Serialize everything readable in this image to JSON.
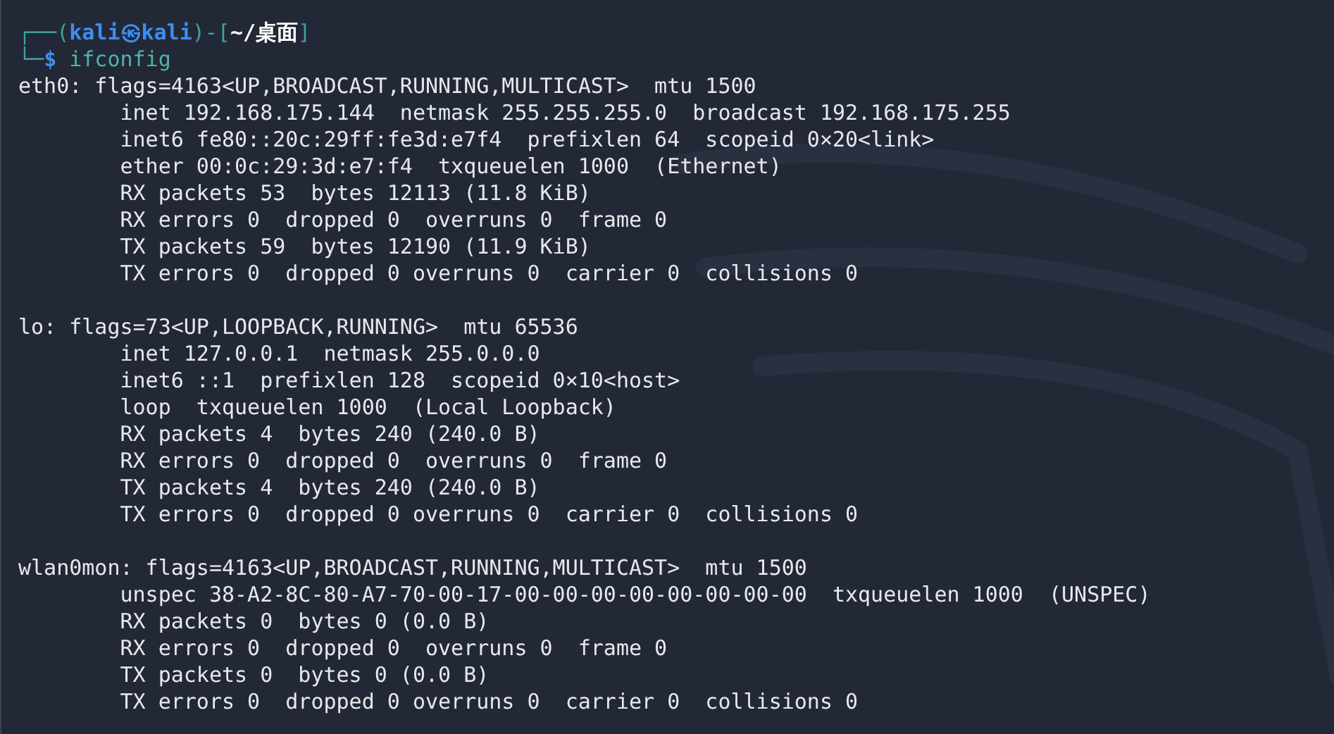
{
  "prompt": {
    "corner_top": "┌──(",
    "user": "kali",
    "separator": "㉿",
    "host": "kali",
    "bracket_mid": ")-[",
    "path": "~/桌面",
    "bracket_close": "]",
    "corner_bottom": "└─",
    "symbol": "$",
    "command": "ifconfig"
  },
  "interfaces": [
    {
      "lines": [
        "eth0: flags=4163<UP,BROADCAST,RUNNING,MULTICAST>  mtu 1500",
        "        inet 192.168.175.144  netmask 255.255.255.0  broadcast 192.168.175.255",
        "        inet6 fe80::20c:29ff:fe3d:e7f4  prefixlen 64  scopeid 0×20<link>",
        "        ether 00:0c:29:3d:e7:f4  txqueuelen 1000  (Ethernet)",
        "        RX packets 53  bytes 12113 (11.8 KiB)",
        "        RX errors 0  dropped 0  overruns 0  frame 0",
        "        TX packets 59  bytes 12190 (11.9 KiB)",
        "        TX errors 0  dropped 0 overruns 0  carrier 0  collisions 0"
      ]
    },
    {
      "lines": [
        "lo: flags=73<UP,LOOPBACK,RUNNING>  mtu 65536",
        "        inet 127.0.0.1  netmask 255.0.0.0",
        "        inet6 ::1  prefixlen 128  scopeid 0×10<host>",
        "        loop  txqueuelen 1000  (Local Loopback)",
        "        RX packets 4  bytes 240 (240.0 B)",
        "        RX errors 0  dropped 0  overruns 0  frame 0",
        "        TX packets 4  bytes 240 (240.0 B)",
        "        TX errors 0  dropped 0 overruns 0  carrier 0  collisions 0"
      ]
    },
    {
      "lines": [
        "wlan0mon: flags=4163<UP,BROADCAST,RUNNING,MULTICAST>  mtu 1500",
        "        unspec 38-A2-8C-80-A7-70-00-17-00-00-00-00-00-00-00-00  txqueuelen 1000  (UNSPEC)",
        "        RX packets 0  bytes 0 (0.0 B)",
        "        RX errors 0  dropped 0  overruns 0  frame 0",
        "        TX packets 0  bytes 0 (0.0 B)",
        "        TX errors 0  dropped 0 overruns 0  carrier 0  collisions 0"
      ]
    }
  ]
}
